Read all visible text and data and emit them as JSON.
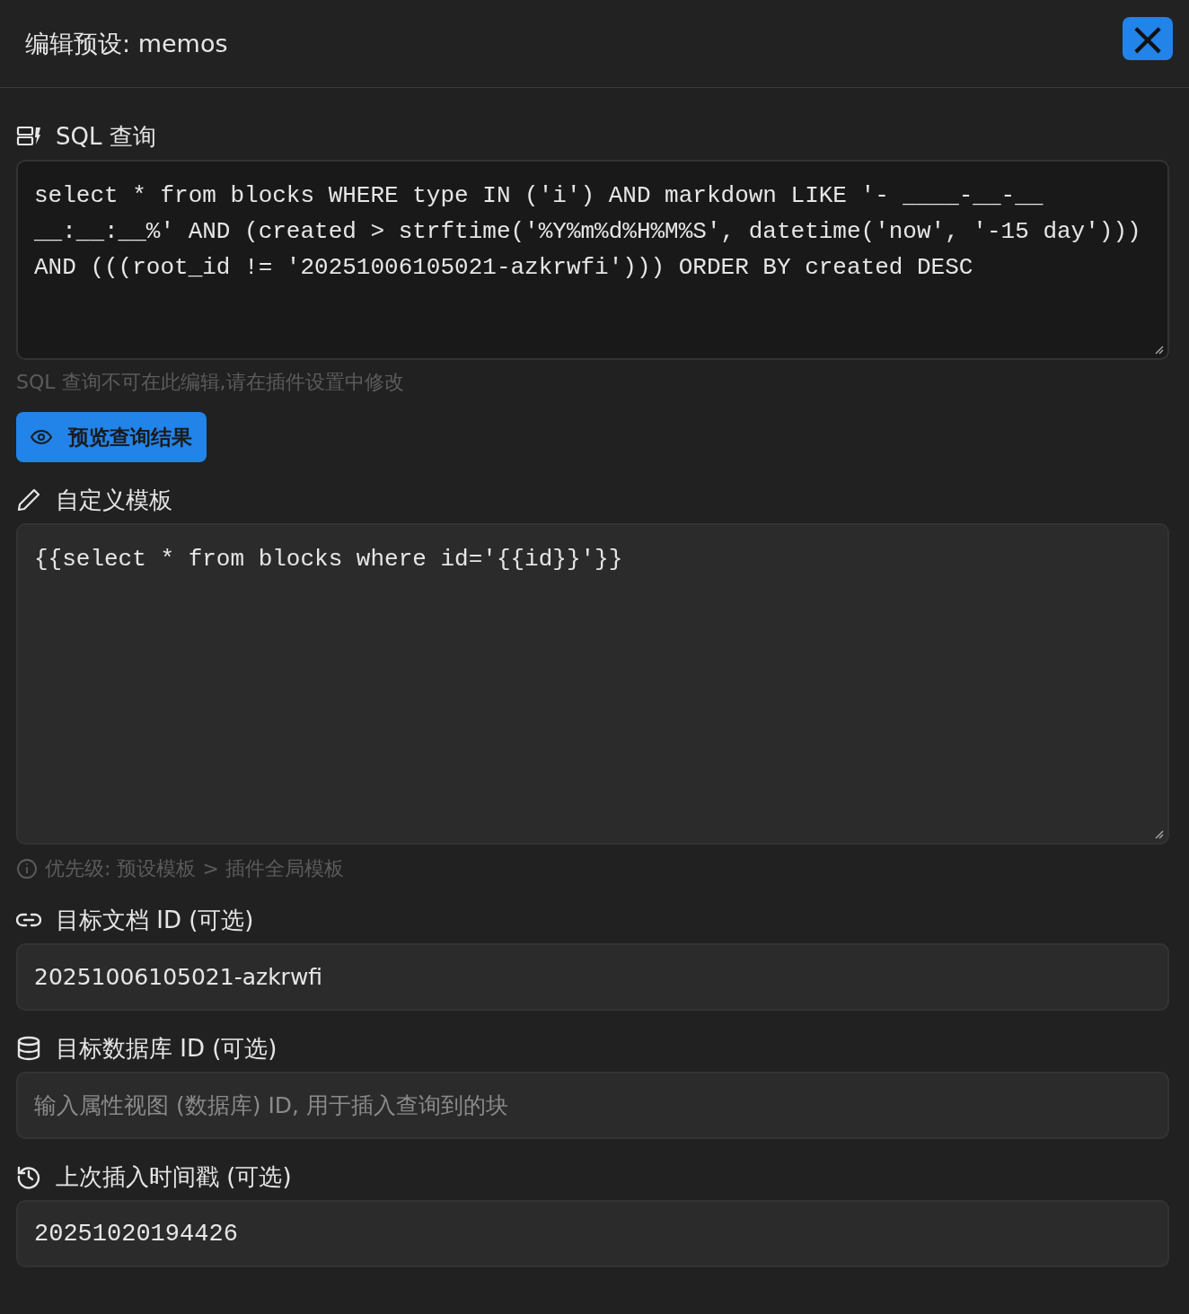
{
  "dialog": {
    "title": "编辑预设: memos",
    "close_icon": "×"
  },
  "sections": [
    {
      "kind": "code",
      "label": "SQL 查询",
      "value": "select * from blocks WHERE type IN ('i') AND markdown LIKE '- ____-__-__ __:__:__%' AND (created > strftime('%Y%m%d%H%M%S', datetime('now', '-15 day'))) AND (((root_id != '20251006105021-azkrwfi'))) ORDER BY created DESC",
      "readonly": true,
      "hint": "SQL 查询不可在此编辑,请在插件设置中修改",
      "button": "预览查询结果"
    },
    {
      "kind": "code",
      "label": "自定义模板",
      "value": "{{select * from blocks where id='{{id}}'}}",
      "readonly": false,
      "info": "优先级: 预设模板 > 插件全局模板"
    },
    {
      "kind": "input",
      "label": "目标文档 ID (可选)",
      "value": "20251006105021-azkrwfi",
      "mono": false
    },
    {
      "kind": "input",
      "label": "目标数据库 ID (可选)",
      "placeholder": "输入属性视图 (数据库) ID, 用于插入查询到的块",
      "mono": false
    },
    {
      "kind": "input",
      "label": "上次插入时间戳 (可选)",
      "value": "20251020194426",
      "mono": true
    }
  ]
}
